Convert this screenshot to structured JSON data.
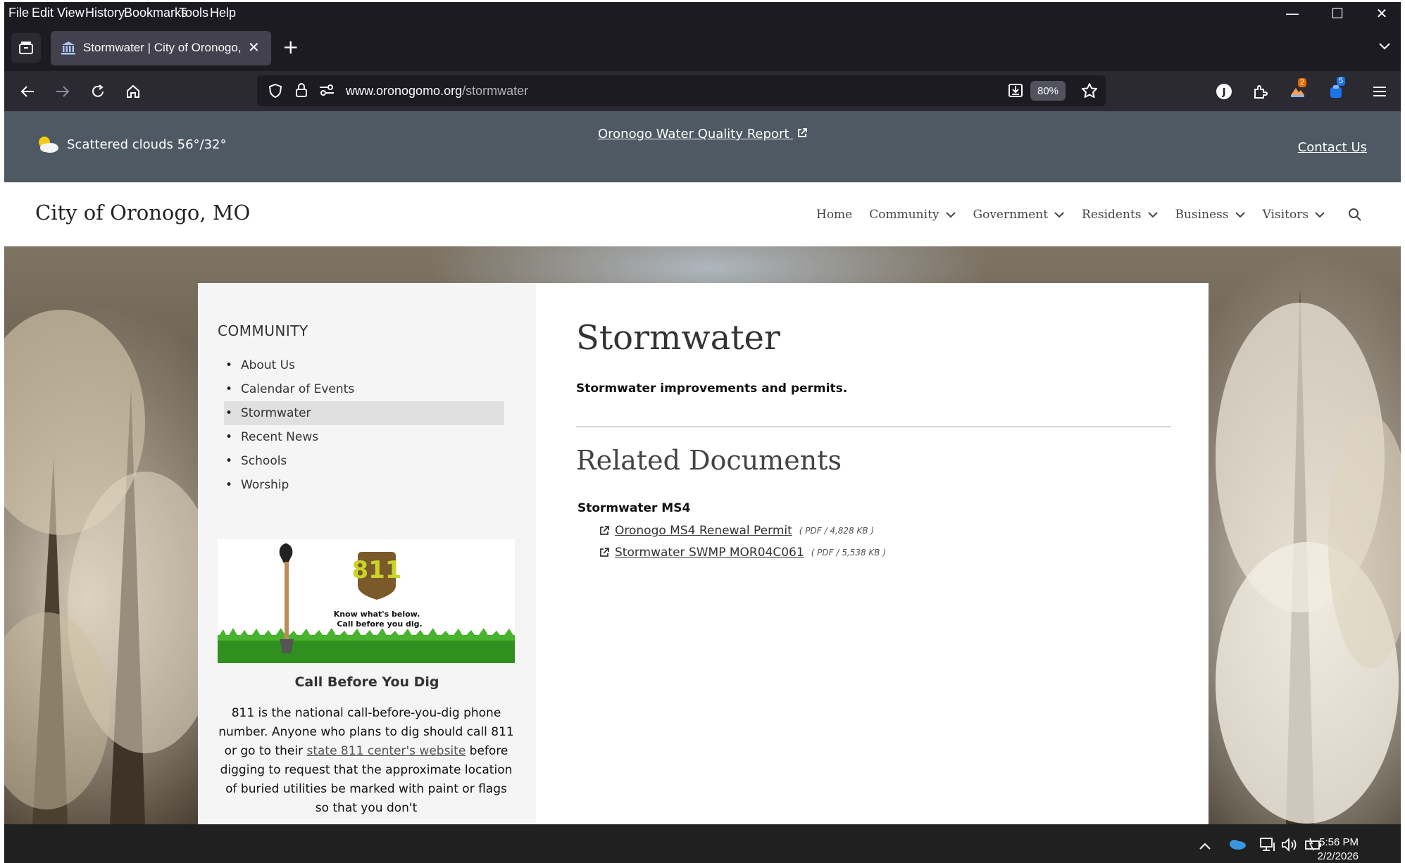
{
  "browser": {
    "menu": [
      "File",
      "Edit",
      "View",
      "History",
      "Bookmarks",
      "Tools",
      "Help"
    ],
    "tab_title": "Stormwater | City of Oronogo, MO",
    "url_domain": "www.oronogomo.org",
    "url_path": "/stormwater",
    "zoom": "80%",
    "badges": {
      "extension_a": "2",
      "extension_b": "5"
    }
  },
  "alert_bar": {
    "weather": "Scattered clouds 56°/32°",
    "water_report": "Oronogo Water Quality Report",
    "contact": "Contact Us"
  },
  "site": {
    "title": "City of Oronogo, MO",
    "nav": [
      "Home",
      "Community",
      "Government",
      "Residents",
      "Business",
      "Visitors"
    ]
  },
  "sidebar": {
    "heading": "COMMUNITY",
    "items": [
      "About Us",
      "Calendar of Events",
      "Stormwater",
      "Recent News",
      "Schools",
      "Worship"
    ],
    "active": "Stormwater",
    "ad": {
      "logo_number": "811",
      "logo_line1": "Know what's below.",
      "logo_line2": "Call before you dig.",
      "title": "Call Before You Dig",
      "text_before": "811 is the national call-before-you-dig phone number. Anyone who plans to dig should call 811 or go to their ",
      "link": "state 811 center's website",
      "text_after": " before digging to request that the approximate location of buried utilities be marked with paint or flags so that you don't"
    }
  },
  "content": {
    "title": "Stormwater",
    "subtitle": "Stormwater improvements and permits.",
    "related_heading": "Related Documents",
    "group": "Stormwater MS4",
    "documents": [
      {
        "name": "Oronogo MS4 Renewal Permit",
        "meta": "( PDF / 4,828 KB )"
      },
      {
        "name": "Stormwater SWMP MOR04C061",
        "meta": "( PDF / 5,538 KB )"
      }
    ]
  },
  "taskbar": {
    "time": "5:56 PM",
    "date": "2/2/2026"
  },
  "colors": {
    "alert_bar": "#4e5963",
    "chrome_dark": "#1c1b22",
    "toolbar": "#2b2a33"
  }
}
